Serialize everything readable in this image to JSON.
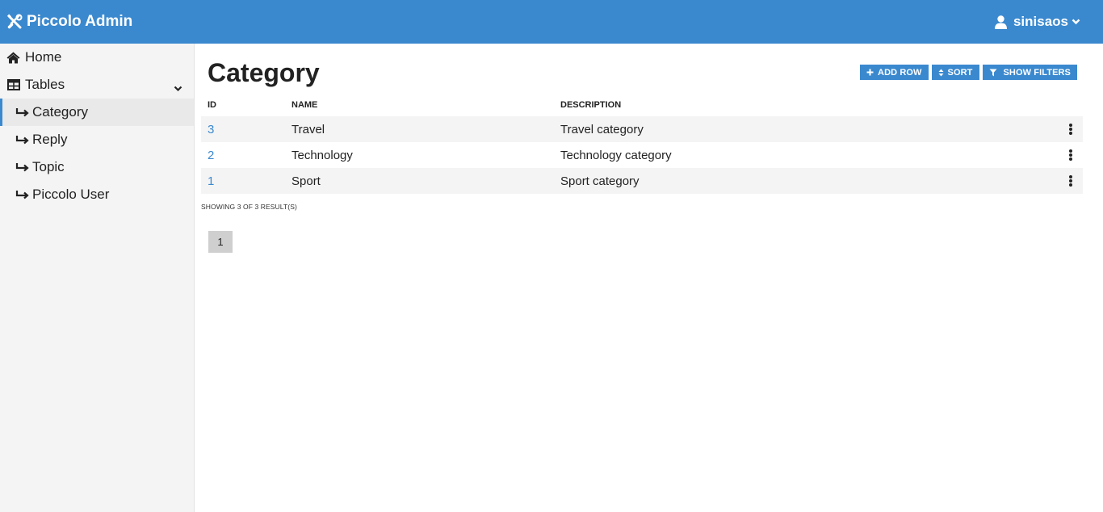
{
  "header": {
    "brand": "Piccolo Admin",
    "username": "sinisaos",
    "color": "#3a89cf"
  },
  "sidebar": {
    "home": "Home",
    "tables": "Tables",
    "items": [
      "Category",
      "Reply",
      "Topic",
      "Piccolo User"
    ],
    "active": "Category"
  },
  "main": {
    "title": "Category",
    "actions": {
      "add_row": "ADD ROW",
      "sort": "SORT",
      "show_filters": "SHOW FILTERS"
    },
    "table": {
      "columns": [
        "ID",
        "NAME",
        "DESCRIPTION"
      ],
      "rows": [
        {
          "id": "3",
          "name": "Travel",
          "description": "Travel category"
        },
        {
          "id": "2",
          "name": "Technology",
          "description": "Technology category"
        },
        {
          "id": "1",
          "name": "Sport",
          "description": "Sport category"
        }
      ]
    },
    "result_count": "SHOWING 3 OF 3 RESULT(S)",
    "pagination": {
      "current_page": "1"
    }
  }
}
